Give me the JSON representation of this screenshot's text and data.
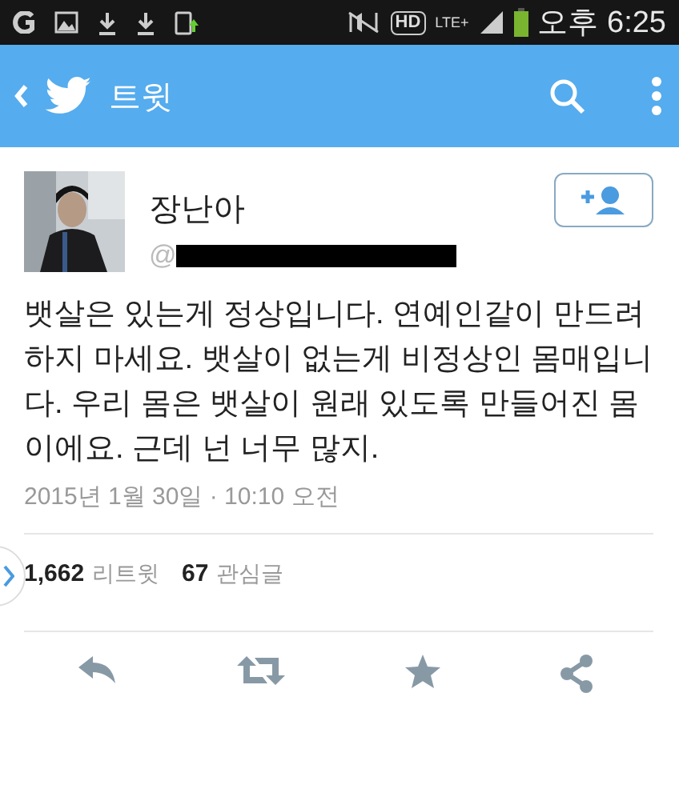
{
  "status_bar": {
    "hd_label": "HD",
    "network": "LTE+",
    "time": "오후 6:25"
  },
  "header": {
    "title": "트윗"
  },
  "tweet": {
    "author": {
      "name": "장난아",
      "handle": "@"
    },
    "text": "뱃살은 있는게 정상입니다. 연예인같이 만드려 하지 마세요. 뱃살이 없는게 비정상인 몸매입니다. 우리 몸은 뱃살이 원래 있도록 만들어진 몸이에요. 근데 넌 너무 많지.",
    "timestamp": "2015년 1월 30일 · 10:10 오전",
    "stats": [
      {
        "count": "1,662",
        "label": "리트윗"
      },
      {
        "count": "67",
        "label": "관심글"
      }
    ]
  }
}
